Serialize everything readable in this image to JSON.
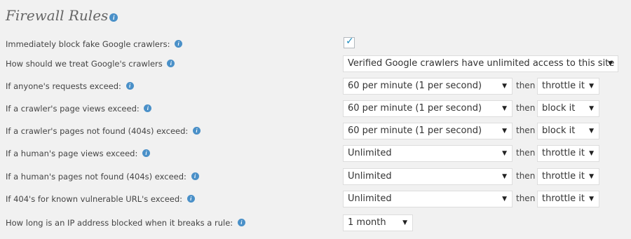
{
  "title": "Firewall Rules",
  "info_glyph": "i",
  "check_glyph": "✓",
  "arrow_glyph": "▼",
  "rows": [
    {
      "label": "Immediately block fake Google crawlers:",
      "checked": true
    },
    {
      "label": "How should we treat Google's crawlers",
      "value": "Verified Google crawlers have unlimited access to this site"
    },
    {
      "label": "If anyone's requests exceed:",
      "value": "60 per minute (1 per second)",
      "then": "then",
      "action": "throttle it"
    },
    {
      "label": "If a crawler's page views exceed:",
      "value": "60 per minute (1 per second)",
      "then": "then",
      "action": "block it"
    },
    {
      "label": "If a crawler's pages not found (404s) exceed:",
      "value": "60 per minute (1 per second)",
      "then": "then",
      "action": "block it"
    },
    {
      "label": "If a human's page views exceed:",
      "value": "Unlimited",
      "then": "then",
      "action": "throttle it"
    },
    {
      "label": "If a human's pages not found (404s) exceed:",
      "value": "Unlimited",
      "then": "then",
      "action": "throttle it"
    },
    {
      "label": "If 404's for known vulnerable URL's exceed:",
      "value": "Unlimited",
      "then": "then",
      "action": "throttle it"
    },
    {
      "label": "How long is an IP address blocked when it breaks a rule:",
      "value": "1 month"
    }
  ]
}
